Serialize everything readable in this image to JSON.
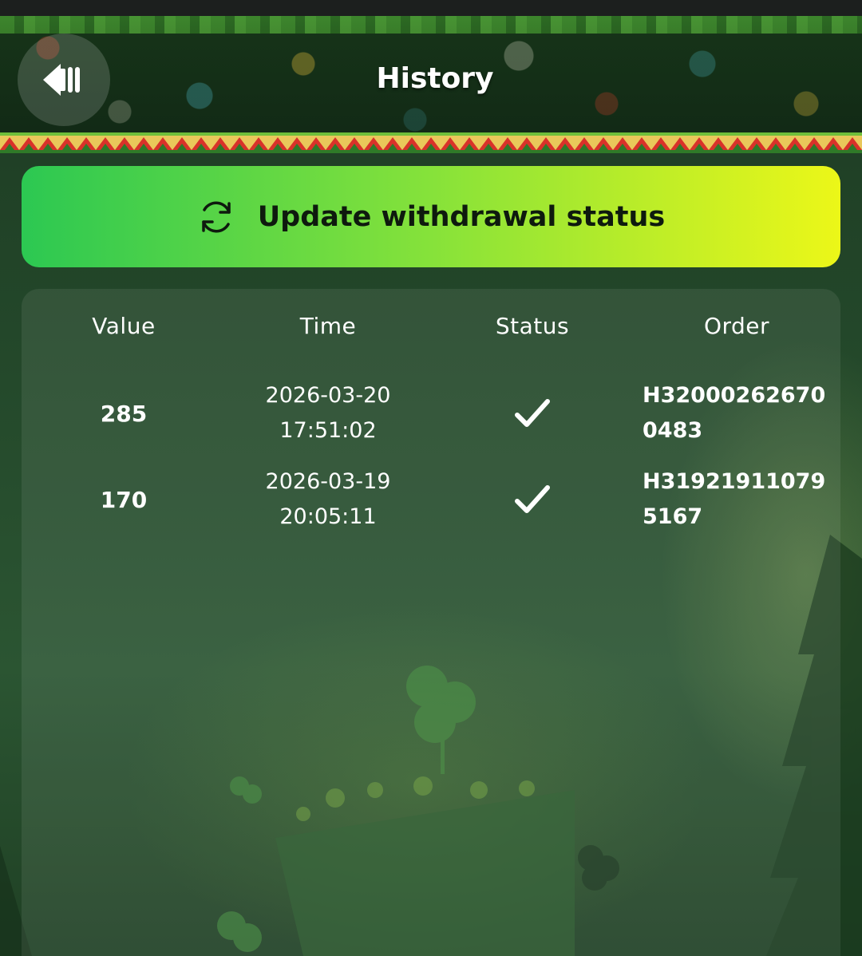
{
  "header": {
    "title": "History",
    "back_icon": "back-arrow-icon"
  },
  "update_button": {
    "label": "Update withdrawal status",
    "icon": "refresh-icon",
    "gradient": [
      "#2cc852",
      "#86e23a",
      "#ecf718"
    ]
  },
  "history": {
    "columns": [
      "Value",
      "Time",
      "Status",
      "Order"
    ],
    "rows": [
      {
        "value": "285",
        "date": "2026-03-20",
        "time": "17:51:02",
        "status_icon": "checkmark-icon",
        "order_line1": "H32000262670",
        "order_line2": "0483"
      },
      {
        "value": "170",
        "date": "2026-03-19",
        "time": "20:05:11",
        "status_icon": "checkmark-icon",
        "order_line1": "H31921911079",
        "order_line2": "5167"
      }
    ]
  },
  "colors": {
    "background": "#24492b",
    "header_zigzag_red": "#d8322a",
    "text": "#ffffff"
  }
}
